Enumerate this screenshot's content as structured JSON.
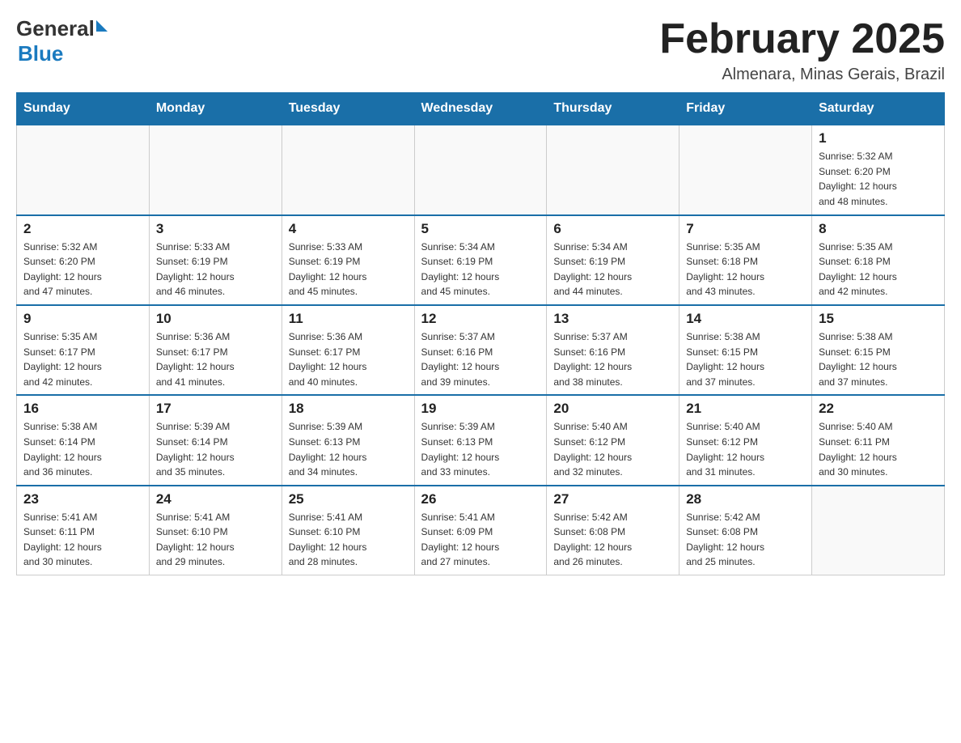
{
  "header": {
    "logo_general": "General",
    "logo_blue": "Blue",
    "month_title": "February 2025",
    "location": "Almenara, Minas Gerais, Brazil"
  },
  "days_of_week": [
    "Sunday",
    "Monday",
    "Tuesday",
    "Wednesday",
    "Thursday",
    "Friday",
    "Saturday"
  ],
  "weeks": [
    [
      {
        "day": "",
        "info": ""
      },
      {
        "day": "",
        "info": ""
      },
      {
        "day": "",
        "info": ""
      },
      {
        "day": "",
        "info": ""
      },
      {
        "day": "",
        "info": ""
      },
      {
        "day": "",
        "info": ""
      },
      {
        "day": "1",
        "info": "Sunrise: 5:32 AM\nSunset: 6:20 PM\nDaylight: 12 hours\nand 48 minutes."
      }
    ],
    [
      {
        "day": "2",
        "info": "Sunrise: 5:32 AM\nSunset: 6:20 PM\nDaylight: 12 hours\nand 47 minutes."
      },
      {
        "day": "3",
        "info": "Sunrise: 5:33 AM\nSunset: 6:19 PM\nDaylight: 12 hours\nand 46 minutes."
      },
      {
        "day": "4",
        "info": "Sunrise: 5:33 AM\nSunset: 6:19 PM\nDaylight: 12 hours\nand 45 minutes."
      },
      {
        "day": "5",
        "info": "Sunrise: 5:34 AM\nSunset: 6:19 PM\nDaylight: 12 hours\nand 45 minutes."
      },
      {
        "day": "6",
        "info": "Sunrise: 5:34 AM\nSunset: 6:19 PM\nDaylight: 12 hours\nand 44 minutes."
      },
      {
        "day": "7",
        "info": "Sunrise: 5:35 AM\nSunset: 6:18 PM\nDaylight: 12 hours\nand 43 minutes."
      },
      {
        "day": "8",
        "info": "Sunrise: 5:35 AM\nSunset: 6:18 PM\nDaylight: 12 hours\nand 42 minutes."
      }
    ],
    [
      {
        "day": "9",
        "info": "Sunrise: 5:35 AM\nSunset: 6:17 PM\nDaylight: 12 hours\nand 42 minutes."
      },
      {
        "day": "10",
        "info": "Sunrise: 5:36 AM\nSunset: 6:17 PM\nDaylight: 12 hours\nand 41 minutes."
      },
      {
        "day": "11",
        "info": "Sunrise: 5:36 AM\nSunset: 6:17 PM\nDaylight: 12 hours\nand 40 minutes."
      },
      {
        "day": "12",
        "info": "Sunrise: 5:37 AM\nSunset: 6:16 PM\nDaylight: 12 hours\nand 39 minutes."
      },
      {
        "day": "13",
        "info": "Sunrise: 5:37 AM\nSunset: 6:16 PM\nDaylight: 12 hours\nand 38 minutes."
      },
      {
        "day": "14",
        "info": "Sunrise: 5:38 AM\nSunset: 6:15 PM\nDaylight: 12 hours\nand 37 minutes."
      },
      {
        "day": "15",
        "info": "Sunrise: 5:38 AM\nSunset: 6:15 PM\nDaylight: 12 hours\nand 37 minutes."
      }
    ],
    [
      {
        "day": "16",
        "info": "Sunrise: 5:38 AM\nSunset: 6:14 PM\nDaylight: 12 hours\nand 36 minutes."
      },
      {
        "day": "17",
        "info": "Sunrise: 5:39 AM\nSunset: 6:14 PM\nDaylight: 12 hours\nand 35 minutes."
      },
      {
        "day": "18",
        "info": "Sunrise: 5:39 AM\nSunset: 6:13 PM\nDaylight: 12 hours\nand 34 minutes."
      },
      {
        "day": "19",
        "info": "Sunrise: 5:39 AM\nSunset: 6:13 PM\nDaylight: 12 hours\nand 33 minutes."
      },
      {
        "day": "20",
        "info": "Sunrise: 5:40 AM\nSunset: 6:12 PM\nDaylight: 12 hours\nand 32 minutes."
      },
      {
        "day": "21",
        "info": "Sunrise: 5:40 AM\nSunset: 6:12 PM\nDaylight: 12 hours\nand 31 minutes."
      },
      {
        "day": "22",
        "info": "Sunrise: 5:40 AM\nSunset: 6:11 PM\nDaylight: 12 hours\nand 30 minutes."
      }
    ],
    [
      {
        "day": "23",
        "info": "Sunrise: 5:41 AM\nSunset: 6:11 PM\nDaylight: 12 hours\nand 30 minutes."
      },
      {
        "day": "24",
        "info": "Sunrise: 5:41 AM\nSunset: 6:10 PM\nDaylight: 12 hours\nand 29 minutes."
      },
      {
        "day": "25",
        "info": "Sunrise: 5:41 AM\nSunset: 6:10 PM\nDaylight: 12 hours\nand 28 minutes."
      },
      {
        "day": "26",
        "info": "Sunrise: 5:41 AM\nSunset: 6:09 PM\nDaylight: 12 hours\nand 27 minutes."
      },
      {
        "day": "27",
        "info": "Sunrise: 5:42 AM\nSunset: 6:08 PM\nDaylight: 12 hours\nand 26 minutes."
      },
      {
        "day": "28",
        "info": "Sunrise: 5:42 AM\nSunset: 6:08 PM\nDaylight: 12 hours\nand 25 minutes."
      },
      {
        "day": "",
        "info": ""
      }
    ]
  ]
}
